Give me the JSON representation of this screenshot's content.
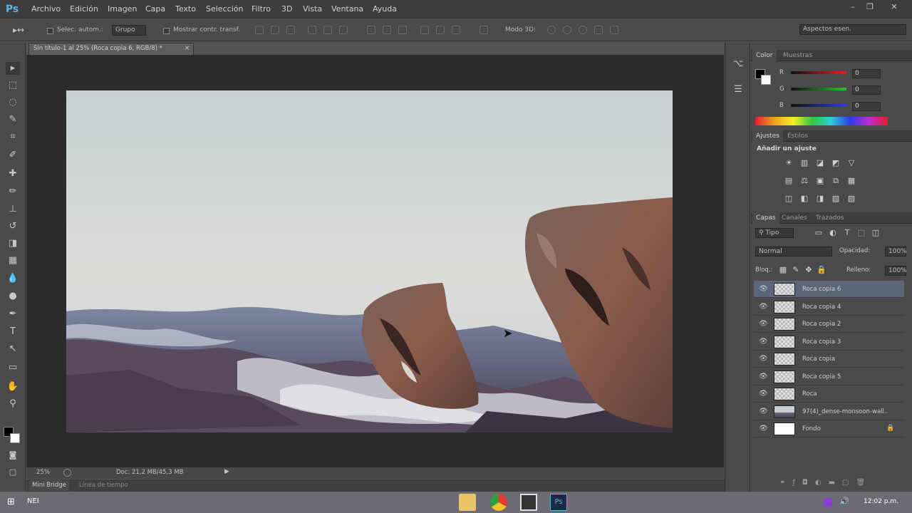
{
  "app": {
    "logo": "Ps"
  },
  "menu": [
    "Archivo",
    "Edición",
    "Imagen",
    "Capa",
    "Texto",
    "Selección",
    "Filtro",
    "3D",
    "Vista",
    "Ventana",
    "Ayuda"
  ],
  "window_controls": {
    "minimize": "–",
    "restore": "❐",
    "close": "✕"
  },
  "options": {
    "auto_select_label": "Selec. autom.:",
    "auto_select_value": "Grupo",
    "show_transform_label": "Mostrar contr. transf.",
    "mode_3d_label": "Modo 3D:",
    "workspace": "Aspectos esen."
  },
  "document": {
    "tab_title": "Sin título-1 al 25% (Roca copia 6, RGB/8) *",
    "tab_close": "×",
    "zoom": "25%",
    "doc_info": "Doc: 21,2 MB/45,3 MB"
  },
  "bottom_tabs": [
    "Mini Bridge",
    "Línea de tiempo"
  ],
  "color_panel": {
    "tabs": [
      "Color",
      "Muestras"
    ],
    "channels": [
      {
        "label": "R",
        "value": "0",
        "color": "#e2202b"
      },
      {
        "label": "G",
        "value": "0",
        "color": "#29c52e"
      },
      {
        "label": "B",
        "value": "0",
        "color": "#2a3ce0"
      }
    ]
  },
  "adjust_panel": {
    "tabs": [
      "Ajustes",
      "Estilos"
    ],
    "heading": "Añadir un ajuste",
    "icons": [
      [
        "☀",
        "▥",
        "◪",
        "◩",
        "▽"
      ],
      [
        "▤",
        "⚖",
        "▣",
        "⧉",
        "▦"
      ],
      [
        "◫",
        "◧",
        "◨",
        "▨",
        "▧"
      ]
    ]
  },
  "layers_panel": {
    "tabs": [
      "Capas",
      "Canales",
      "Trazados"
    ],
    "filter_label": "Tipo",
    "blend_mode": "Normal",
    "opacity_label": "Opacidad:",
    "opacity_value": "100%",
    "lock_label": "Bloq.:",
    "fill_label": "Relleno:",
    "fill_value": "100%",
    "layers": [
      {
        "name": "Roca copia 6",
        "selected": true,
        "thumb": "transparent"
      },
      {
        "name": "Roca copia 4",
        "selected": false,
        "thumb": "transparent"
      },
      {
        "name": "Roca copia 2",
        "selected": false,
        "thumb": "transparent"
      },
      {
        "name": "Roca copia 3",
        "selected": false,
        "thumb": "transparent"
      },
      {
        "name": "Roca copia",
        "selected": false,
        "thumb": "transparent"
      },
      {
        "name": "Roca copia 5",
        "selected": false,
        "thumb": "transparent"
      },
      {
        "name": "Roca",
        "selected": false,
        "thumb": "transparent"
      },
      {
        "name": "97(4)_dense-monsoon-wall...",
        "selected": false,
        "thumb": "photo"
      },
      {
        "name": "Fondo",
        "selected": false,
        "thumb": "white",
        "locked": true
      }
    ]
  },
  "taskbar": {
    "lang": "NEI",
    "time": "12:02 p.m."
  }
}
